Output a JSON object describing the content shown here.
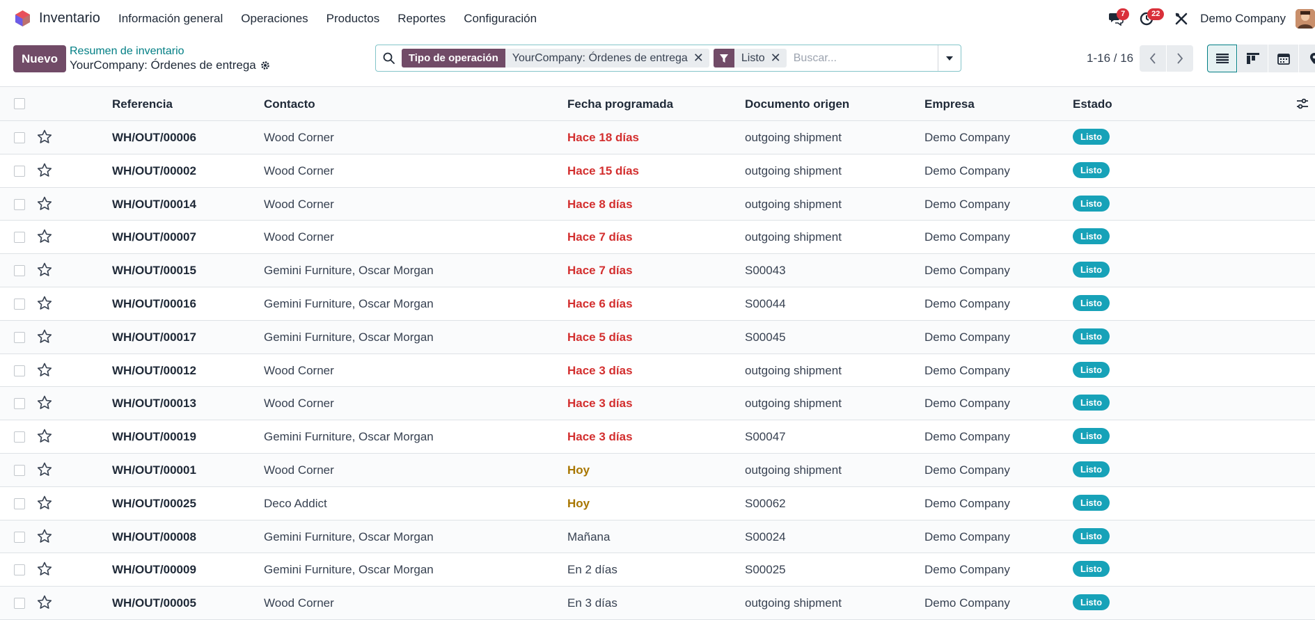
{
  "app": {
    "name": "Inventario",
    "logo_icon": "odoo-inventory-icon"
  },
  "menu": [
    "Información general",
    "Operaciones",
    "Productos",
    "Reportes",
    "Configuración"
  ],
  "systray": {
    "messages_count": "7",
    "activities_count": "22",
    "company": "Demo Company"
  },
  "control": {
    "new_label": "Nuevo",
    "breadcrumb_parent": "Resumen de inventario",
    "breadcrumb_current": "YourCompany: Órdenes de entrega"
  },
  "search": {
    "facets": [
      {
        "label": "Tipo de operación",
        "value": "YourCompany: Órdenes de entrega"
      },
      {
        "label": "",
        "value": "Listo",
        "icon": "filter-icon"
      }
    ],
    "placeholder": "Buscar..."
  },
  "pager": {
    "value": "1-16 / 16"
  },
  "columns": [
    "Referencia",
    "Contacto",
    "Fecha programada",
    "Documento origen",
    "Empresa",
    "Estado"
  ],
  "rows": [
    {
      "ref": "WH/OUT/00006",
      "contact": "Wood Corner",
      "date": "Hace 18 días",
      "date_state": "late",
      "origin": "outgoing shipment",
      "company": "Demo Company",
      "status": "Listo"
    },
    {
      "ref": "WH/OUT/00002",
      "contact": "Wood Corner",
      "date": "Hace 15 días",
      "date_state": "late",
      "origin": "outgoing shipment",
      "company": "Demo Company",
      "status": "Listo"
    },
    {
      "ref": "WH/OUT/00014",
      "contact": "Wood Corner",
      "date": "Hace 8 días",
      "date_state": "late",
      "origin": "outgoing shipment",
      "company": "Demo Company",
      "status": "Listo"
    },
    {
      "ref": "WH/OUT/00007",
      "contact": "Wood Corner",
      "date": "Hace 7 días",
      "date_state": "late",
      "origin": "outgoing shipment",
      "company": "Demo Company",
      "status": "Listo"
    },
    {
      "ref": "WH/OUT/00015",
      "contact": "Gemini Furniture, Oscar Morgan",
      "date": "Hace 7 días",
      "date_state": "late",
      "origin": "S00043",
      "company": "Demo Company",
      "status": "Listo"
    },
    {
      "ref": "WH/OUT/00016",
      "contact": "Gemini Furniture, Oscar Morgan",
      "date": "Hace 6 días",
      "date_state": "late",
      "origin": "S00044",
      "company": "Demo Company",
      "status": "Listo"
    },
    {
      "ref": "WH/OUT/00017",
      "contact": "Gemini Furniture, Oscar Morgan",
      "date": "Hace 5 días",
      "date_state": "late",
      "origin": "S00045",
      "company": "Demo Company",
      "status": "Listo"
    },
    {
      "ref": "WH/OUT/00012",
      "contact": "Wood Corner",
      "date": "Hace 3 días",
      "date_state": "late",
      "origin": "outgoing shipment",
      "company": "Demo Company",
      "status": "Listo"
    },
    {
      "ref": "WH/OUT/00013",
      "contact": "Wood Corner",
      "date": "Hace 3 días",
      "date_state": "late",
      "origin": "outgoing shipment",
      "company": "Demo Company",
      "status": "Listo"
    },
    {
      "ref": "WH/OUT/00019",
      "contact": "Gemini Furniture, Oscar Morgan",
      "date": "Hace 3 días",
      "date_state": "late",
      "origin": "S00047",
      "company": "Demo Company",
      "status": "Listo"
    },
    {
      "ref": "WH/OUT/00001",
      "contact": "Wood Corner",
      "date": "Hoy",
      "date_state": "today",
      "origin": "outgoing shipment",
      "company": "Demo Company",
      "status": "Listo"
    },
    {
      "ref": "WH/OUT/00025",
      "contact": "Deco Addict",
      "date": "Hoy",
      "date_state": "today",
      "origin": "S00062",
      "company": "Demo Company",
      "status": "Listo"
    },
    {
      "ref": "WH/OUT/00008",
      "contact": "Gemini Furniture, Oscar Morgan",
      "date": "Mañana",
      "date_state": "future",
      "origin": "S00024",
      "company": "Demo Company",
      "status": "Listo"
    },
    {
      "ref": "WH/OUT/00009",
      "contact": "Gemini Furniture, Oscar Morgan",
      "date": "En 2 días",
      "date_state": "future",
      "origin": "S00025",
      "company": "Demo Company",
      "status": "Listo"
    },
    {
      "ref": "WH/OUT/00005",
      "contact": "Wood Corner",
      "date": "En 3 días",
      "date_state": "future",
      "origin": "outgoing shipment",
      "company": "Demo Company",
      "status": "Listo"
    }
  ],
  "colors": {
    "brand": "#714b67",
    "link": "#017e84",
    "late": "#d32f2f",
    "today": "#a87600",
    "status_ready": "#17a2b8",
    "badge": "#d9303a"
  }
}
